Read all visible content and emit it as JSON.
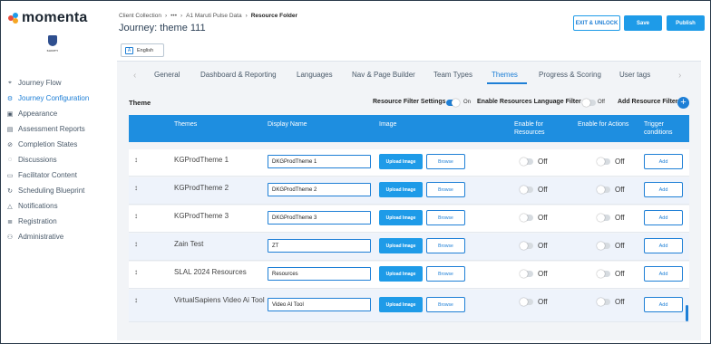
{
  "app": {
    "name": "momenta",
    "org_badge": "SANITY"
  },
  "sidebar": {
    "items": [
      {
        "label": "Journey Flow",
        "icon": "location-pin-icon",
        "active": false
      },
      {
        "label": "Journey Configuration",
        "icon": "gear-icon",
        "active": true
      },
      {
        "label": "Appearance",
        "icon": "image-icon",
        "active": false
      },
      {
        "label": "Assessment Reports",
        "icon": "document-icon",
        "active": false
      },
      {
        "label": "Completion States",
        "icon": "check-circle-icon",
        "active": false
      },
      {
        "label": "Discussions",
        "icon": "chat-icon",
        "active": false
      },
      {
        "label": "Facilitator Content",
        "icon": "folder-icon",
        "active": false
      },
      {
        "label": "Scheduling Blueprint",
        "icon": "sync-icon",
        "active": false
      },
      {
        "label": "Notifications",
        "icon": "bell-icon",
        "active": false
      },
      {
        "label": "Registration",
        "icon": "list-icon",
        "active": false
      },
      {
        "label": "Administrative",
        "icon": "admin-icon",
        "active": false
      }
    ]
  },
  "header": {
    "breadcrumb": [
      "Client Collection",
      "•••",
      "A1 Maruti Pulse Data",
      "Resource Folder"
    ],
    "title": "Journey: theme 111",
    "exit_unlock_label": "EXIT & UNLOCK",
    "save_label": "Save",
    "publish_label": "Publish",
    "language_tab": "English"
  },
  "tabs": {
    "items": [
      "General",
      "Dashboard & Reporting",
      "Languages",
      "Nav & Page Builder",
      "Team Types",
      "Themes",
      "Progress & Scoring",
      "User tags"
    ],
    "active": "Themes"
  },
  "theme_section": {
    "title": "Theme",
    "resource_filter_label": "Resource Filter Settings",
    "resource_filter_state": "On",
    "language_filter_label": "Enable Resources Language Filter",
    "language_filter_state": "Off",
    "add_resource_filter_label": "Add Resource Filter"
  },
  "table": {
    "columns": [
      "Themes",
      "Display Name",
      "Image",
      "Enable for Resources",
      "Enable for Actions",
      "Trigger conditions"
    ],
    "upload_label": "Upload Image",
    "browse_label": "Browse",
    "add_label": "Add",
    "rows": [
      {
        "theme": "KGProdTheme 1",
        "display_name": "DKGProdTheme 1",
        "resources": "Off",
        "actions": "Off"
      },
      {
        "theme": "KGProdTheme 2",
        "display_name": "DKGProdTheme 2",
        "resources": "Off",
        "actions": "Off"
      },
      {
        "theme": "KGProdTheme 3",
        "display_name": "DKGProdTheme 3",
        "resources": "Off",
        "actions": "Off"
      },
      {
        "theme": "Zain Test",
        "display_name": "ZT",
        "resources": "Off",
        "actions": "Off"
      },
      {
        "theme": "SLAL 2024 Resources",
        "display_name": "Resources",
        "resources": "Off",
        "actions": "Off"
      },
      {
        "theme": "VirtualSapiens Video Ai Tool",
        "display_name": "Video AI Tool",
        "resources": "Off",
        "actions": "Off"
      }
    ]
  },
  "colors": {
    "accent": "#1e7fd6",
    "header_bg": "#1e8ee0",
    "panel_bg": "#f2f4f7"
  }
}
